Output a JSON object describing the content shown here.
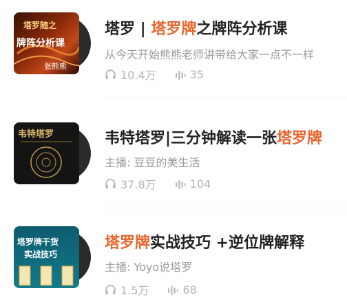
{
  "items": [
    {
      "title_prefix": "塔罗 | ",
      "title_highlight": "塔罗牌",
      "title_suffix": "之牌阵分析课",
      "subtitle": "从今天开始熊熊老师讲带给大家一点不一样",
      "plays": "10.4万",
      "episodes": "35",
      "cover": {
        "line1": "塔罗随之",
        "line2": "牌阵分析课",
        "line3": "张熊熊"
      }
    },
    {
      "title_prefix": "韦特塔罗|三分钟解读一张",
      "title_highlight": "塔罗牌",
      "title_suffix": "",
      "subtitle": "主播: 豆豆的美生活",
      "plays": "37.8万",
      "episodes": "104",
      "cover": {
        "line1": "韦特塔罗"
      }
    },
    {
      "title_prefix": "",
      "title_highlight": "塔罗牌",
      "title_suffix": "实战技巧 +逆位牌解释",
      "subtitle": "主播: Yoyo说塔罗",
      "plays": "1.5万",
      "episodes": "68",
      "cover": {
        "line1": "塔罗牌干货",
        "line2": "实战技巧"
      }
    }
  ],
  "colors": {
    "highlight": "#e8652c",
    "text": "#222222",
    "muted": "#9a9a9a"
  },
  "icons": {
    "plays": "headphones-icon",
    "episodes": "audio-bars-icon"
  }
}
